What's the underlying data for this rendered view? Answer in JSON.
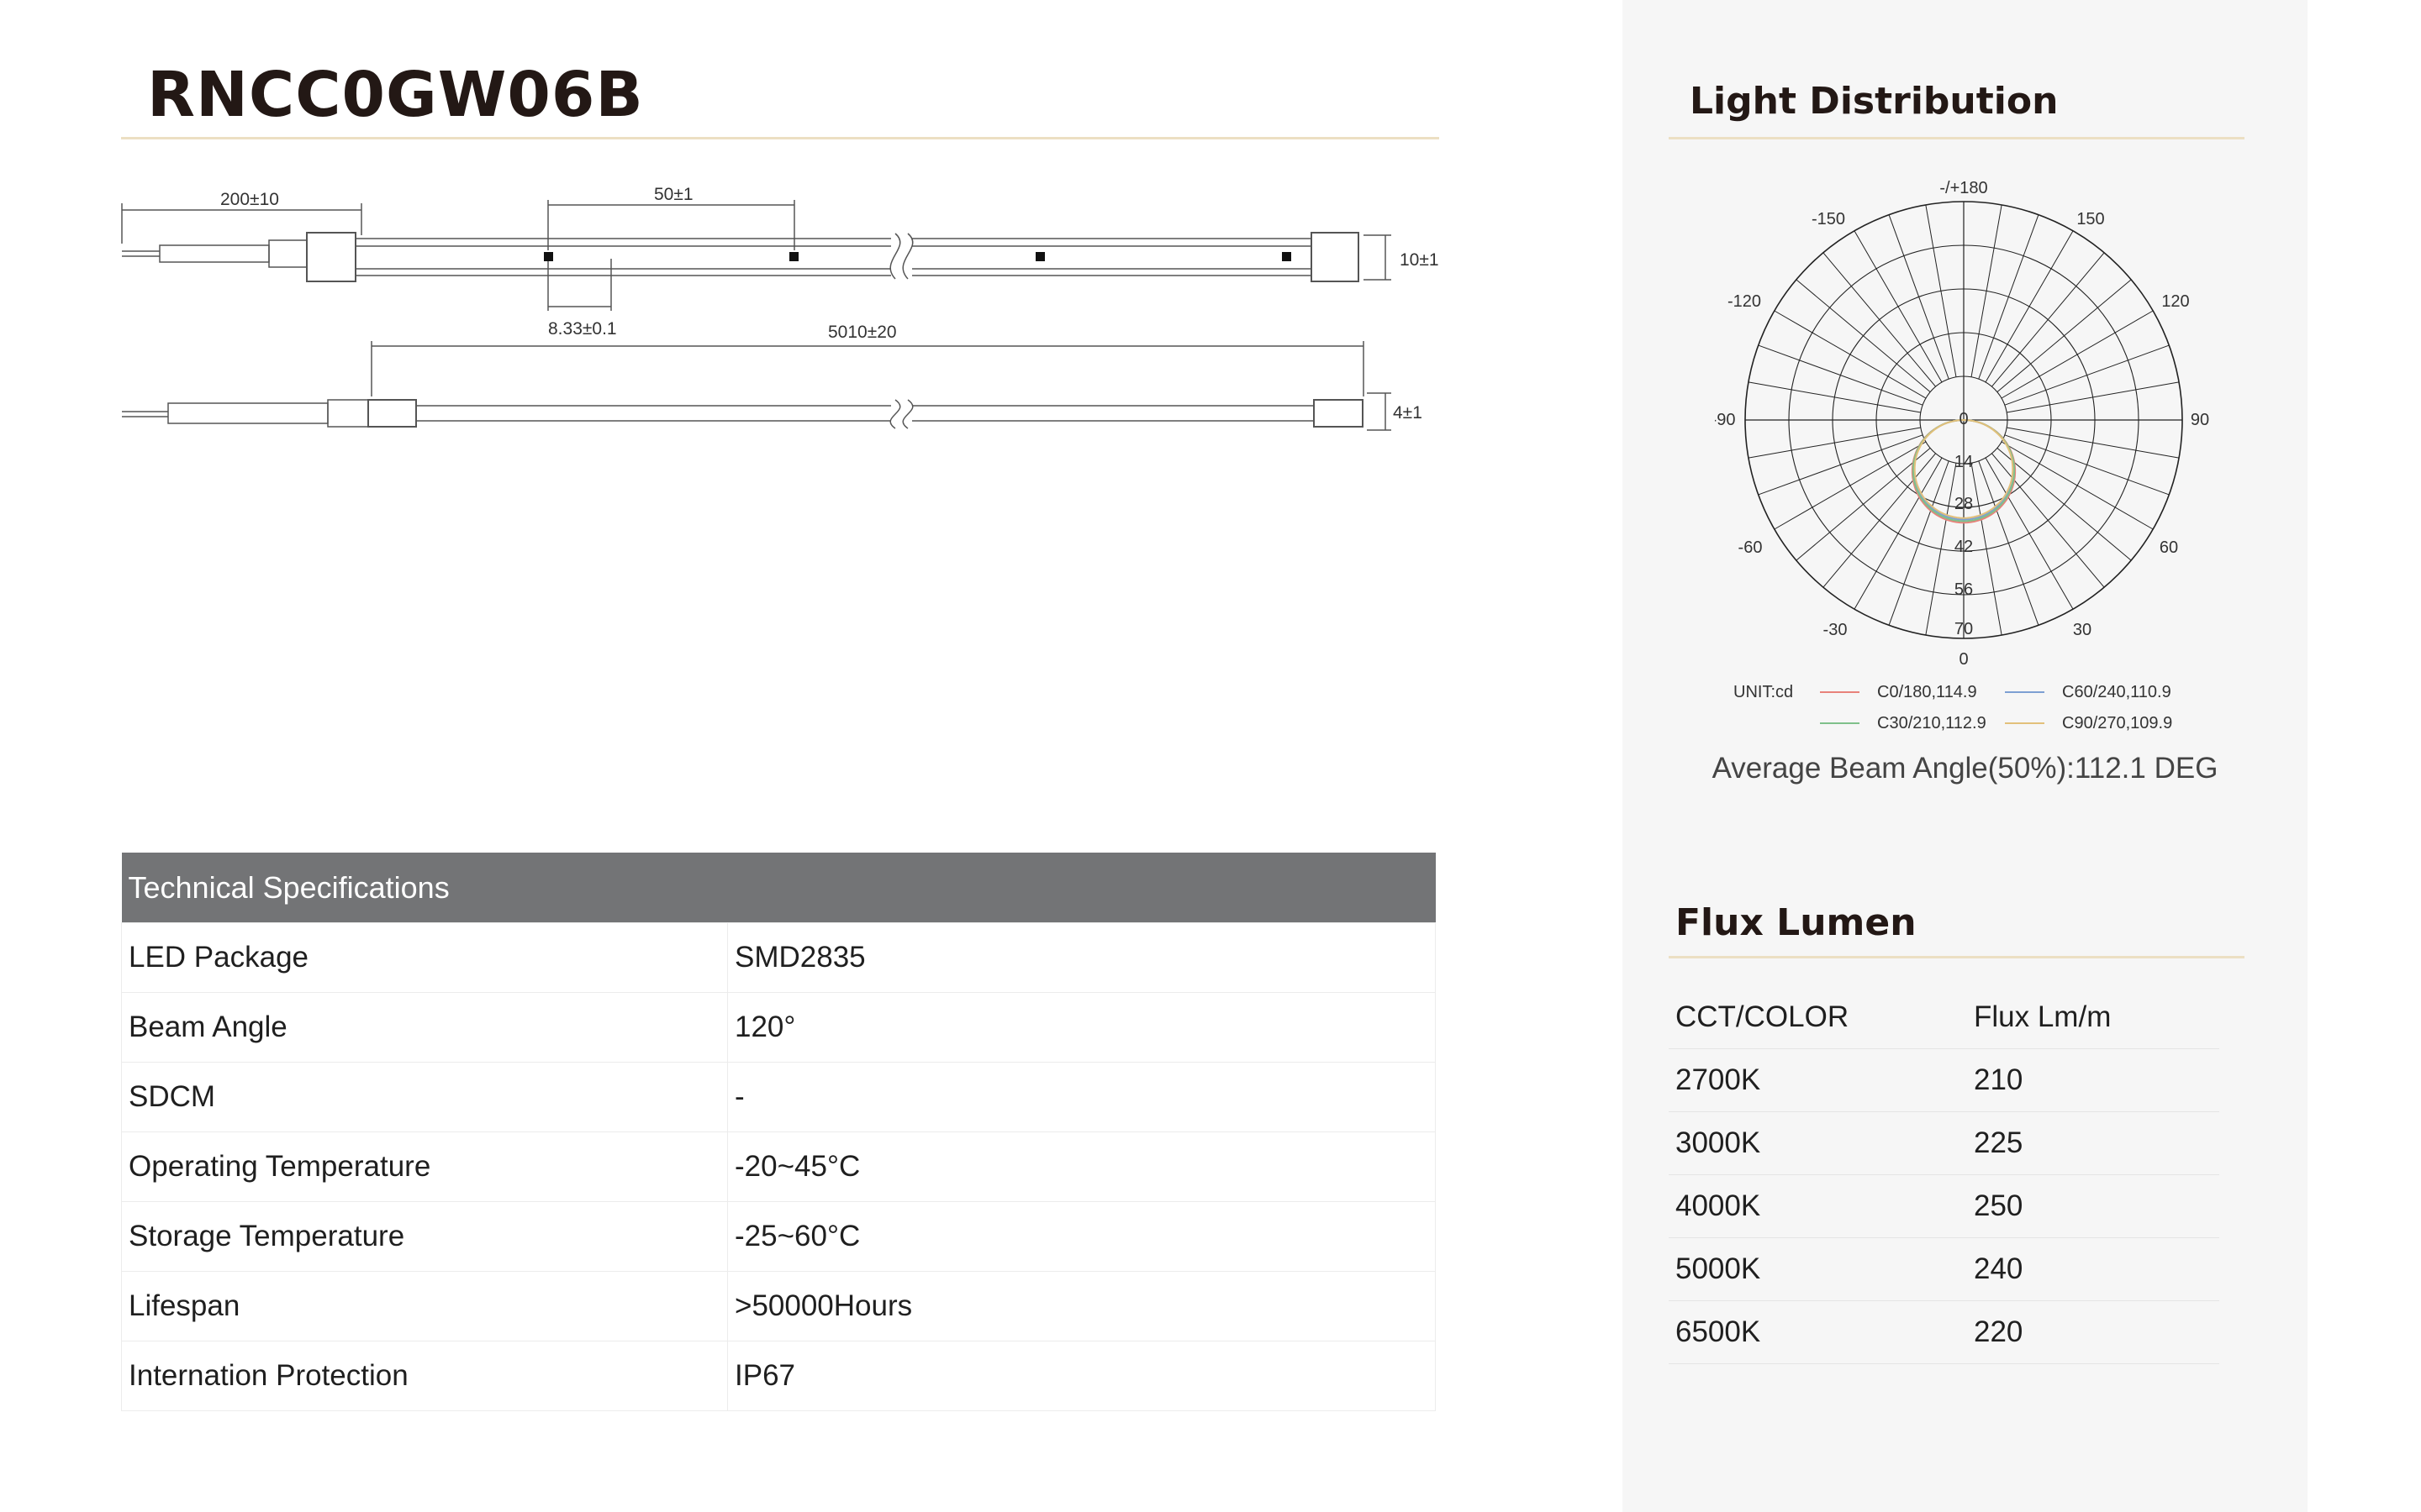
{
  "product": {
    "code": "RNCC0GW06B"
  },
  "drawing": {
    "dims": {
      "lead": "200±10",
      "pitch": "50±1",
      "height": "10±1",
      "led_size": "8.33±0.1",
      "length": "5010±20",
      "thickness": "4±1"
    }
  },
  "specs": {
    "header": "Technical Specifications",
    "rows": [
      {
        "key": "LED Package",
        "value": "SMD2835"
      },
      {
        "key": "Beam Angle",
        "value": "120°"
      },
      {
        "key": "SDCM",
        "value": "-"
      },
      {
        "key": "Operating Temperature",
        "value": "-20~45°C"
      },
      {
        "key": "Storage Temperature",
        "value": "-25~60°C"
      },
      {
        "key": "Lifespan",
        "value": ">50000Hours"
      },
      {
        "key": "Internation Protection",
        "value": "IP67"
      }
    ]
  },
  "light_distribution": {
    "title": "Light Distribution",
    "angle_labels": {
      "top": "-/+180",
      "m150": "-150",
      "p150": "150",
      "m120": "-120",
      "p120": "120",
      "m90": "-90",
      "p90": "90",
      "m60": "-60",
      "p60": "60",
      "m30": "-30",
      "p30": "30",
      "bottom": "0"
    },
    "radial_labels": [
      "0",
      "14",
      "28",
      "42",
      "56",
      "70"
    ],
    "unit_label": "UNIT:cd",
    "legend": [
      {
        "label": "C0/180,114.9",
        "color": "#e8827a"
      },
      {
        "label": "C60/240,110.9",
        "color": "#7d9fd3"
      },
      {
        "label": "C30/210,112.9",
        "color": "#7fc08a"
      },
      {
        "label": "C90/270,109.9",
        "color": "#e2c07a"
      }
    ],
    "beam_note": "Average Beam Angle(50%):112.1 DEG"
  },
  "flux": {
    "title": "Flux Lumen",
    "header": {
      "c1": "CCT/COLOR",
      "c2": "Flux Lm/m"
    },
    "rows": [
      {
        "cct": "2700K",
        "flux": "210"
      },
      {
        "cct": "3000K",
        "flux": "225"
      },
      {
        "cct": "4000K",
        "flux": "250"
      },
      {
        "cct": "5000K",
        "flux": "240"
      },
      {
        "cct": "6500K",
        "flux": "220"
      }
    ]
  }
}
